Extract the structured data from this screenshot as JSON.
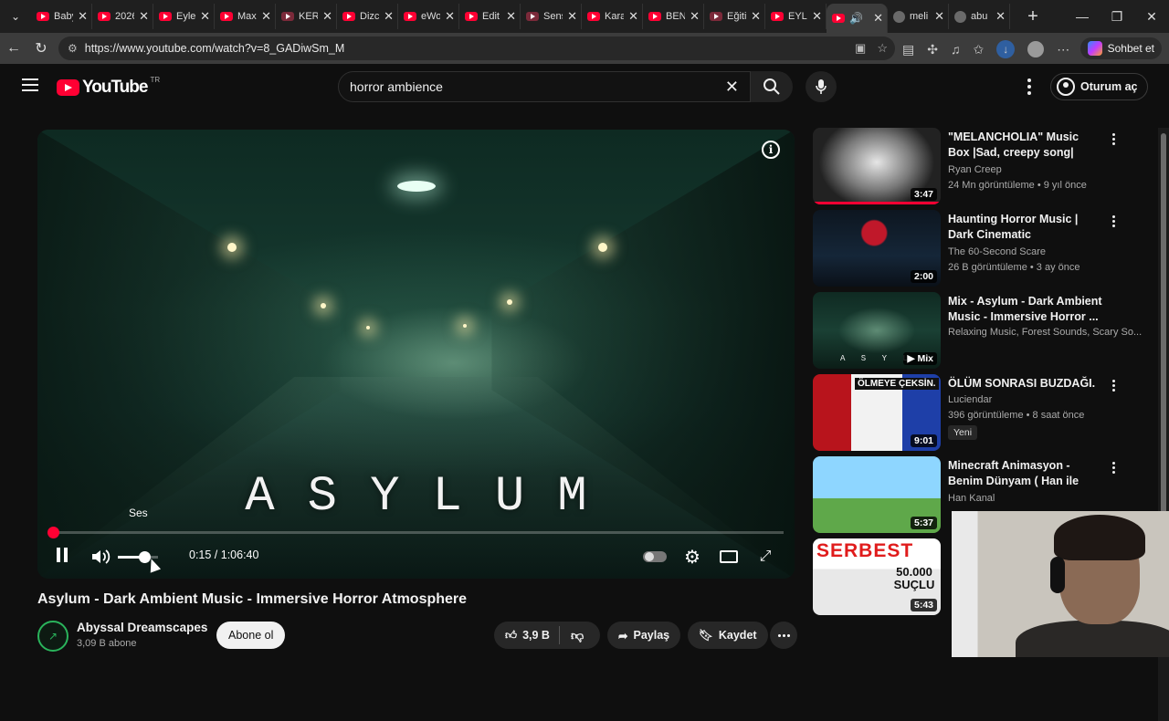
{
  "browser": {
    "tabs": [
      {
        "label": "Baby",
        "icon": "youtube-icon"
      },
      {
        "label": "2026",
        "icon": "youtube-icon"
      },
      {
        "label": "Eylem",
        "icon": "youtube-icon"
      },
      {
        "label": "Max",
        "icon": "youtube-icon"
      },
      {
        "label": "KERT",
        "icon": "youtube-icon"
      },
      {
        "label": "Dizc",
        "icon": "youtube-icon"
      },
      {
        "label": "eWo",
        "icon": "youtube-icon"
      },
      {
        "label": "Edit",
        "icon": "youtube-icon"
      },
      {
        "label": "Sens",
        "icon": "youtube-icon"
      },
      {
        "label": "Kara",
        "icon": "youtube-icon"
      },
      {
        "label": "BEN",
        "icon": "youtube-icon"
      },
      {
        "label": "Eğiti",
        "icon": "youtube-icon"
      },
      {
        "label": "EYLE",
        "icon": "youtube-icon"
      },
      {
        "label": "",
        "icon": "youtube-icon",
        "active": true
      },
      {
        "label": "meli",
        "icon": "globe-icon"
      },
      {
        "label": "abu",
        "icon": "globe-icon"
      }
    ],
    "url": "https://www.youtube.com/watch?v=8_GADiwSm_M",
    "chat_label": "Sohbet et"
  },
  "youtube": {
    "logo_text": "YouTube",
    "country_code": "TR",
    "search_value": "horror ambience",
    "signin_label": "Oturum aç",
    "player": {
      "overlay_title": "ASYLUM",
      "volume_tooltip": "Ses",
      "time": "0:15 / 1:06:40",
      "progress_fraction": 0.004,
      "volume_fraction": 0.65
    },
    "video": {
      "title": "Asylum - Dark Ambient Music - Immersive Horror Atmosphere",
      "channel": "Abyssal Dreamscapes",
      "subscribers": "3,09 B abone",
      "subscribe_label": "Abone ol",
      "likes": "3,9 B",
      "share_label": "Paylaş",
      "save_label": "Kaydet"
    },
    "recommendations": [
      {
        "title": "\"MELANCHOLIA\" Music Box |Sad, creepy song|",
        "channel": "Ryan Creep",
        "meta": "24 Mn görüntüleme • 9 yıl önce",
        "duration": "3:47",
        "watched_fraction": 1.0
      },
      {
        "title": "Haunting Horror Music | Dark Cinematic Soundscapes for ...",
        "channel": "The 60-Second Scare",
        "meta": "26 B görüntüleme • 3 ay önce",
        "duration": "2:00"
      },
      {
        "title": "Mix - Asylum - Dark Ambient Music - Immersive Horror ...",
        "channel": "Relaxing Music, Forest Sounds, Scary So...",
        "meta": "",
        "duration": "Mix",
        "thumb_text": "A S Y L U"
      },
      {
        "title": "ÖLÜM SONRASI BUZDAĞI.",
        "channel": "Luciendar",
        "meta": "396 görüntüleme • 8 saat önce",
        "duration": "9:01",
        "badge": "Yeni",
        "thumb_text": "ÖLMEYE ÇEKSİN."
      },
      {
        "title": "Minecraft Animasyon - Benim Dünyam ( Han ile Kaan Düet )",
        "channel": "Han Kanal",
        "meta": "",
        "duration": "5:37"
      },
      {
        "title": "",
        "channel": "",
        "meta": "",
        "duration": "5:43",
        "thumb_text": "SERBEST",
        "thumb_sub": "50.000 SUÇLU"
      }
    ]
  }
}
